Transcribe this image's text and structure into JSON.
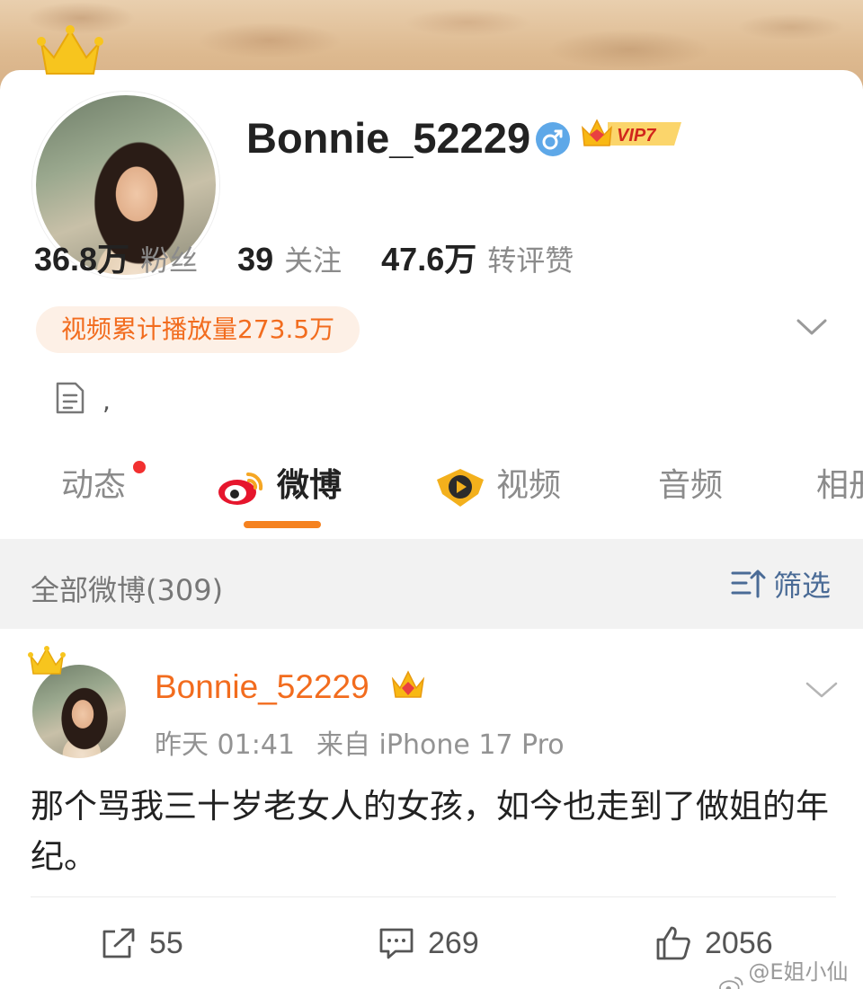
{
  "profile": {
    "name": "Bonnie_52229",
    "gender": "♂",
    "vip_label": "VIP7",
    "stats": [
      {
        "value": "36.8万",
        "label": "粉丝"
      },
      {
        "value": "39",
        "label": "关注"
      },
      {
        "value": "47.6万",
        "label": "转评赞"
      }
    ],
    "play_count_text": "视频累计播放量273.5万",
    "bio": ","
  },
  "tabs": [
    {
      "label": "动态"
    },
    {
      "label": "微博"
    },
    {
      "label": "视频"
    },
    {
      "label": "音频"
    },
    {
      "label": "相册"
    }
  ],
  "filter_bar": {
    "title": "全部微博(309)",
    "filter_label": "筛选"
  },
  "post": {
    "author": "Bonnie_52229",
    "time": "昨天 01:41",
    "source": "来自 iPhone 17 Pro",
    "text": "那个骂我三十岁老女人的女孩，如今也走到了做姐的年纪。",
    "repost_count": "55",
    "comment_count": "269",
    "like_count": "2056"
  },
  "watermark": "@E姐小仙女",
  "colors": {
    "accent_orange": "#f26c1e",
    "filter_blue": "#4a6b96",
    "notification_red": "#f23030"
  }
}
